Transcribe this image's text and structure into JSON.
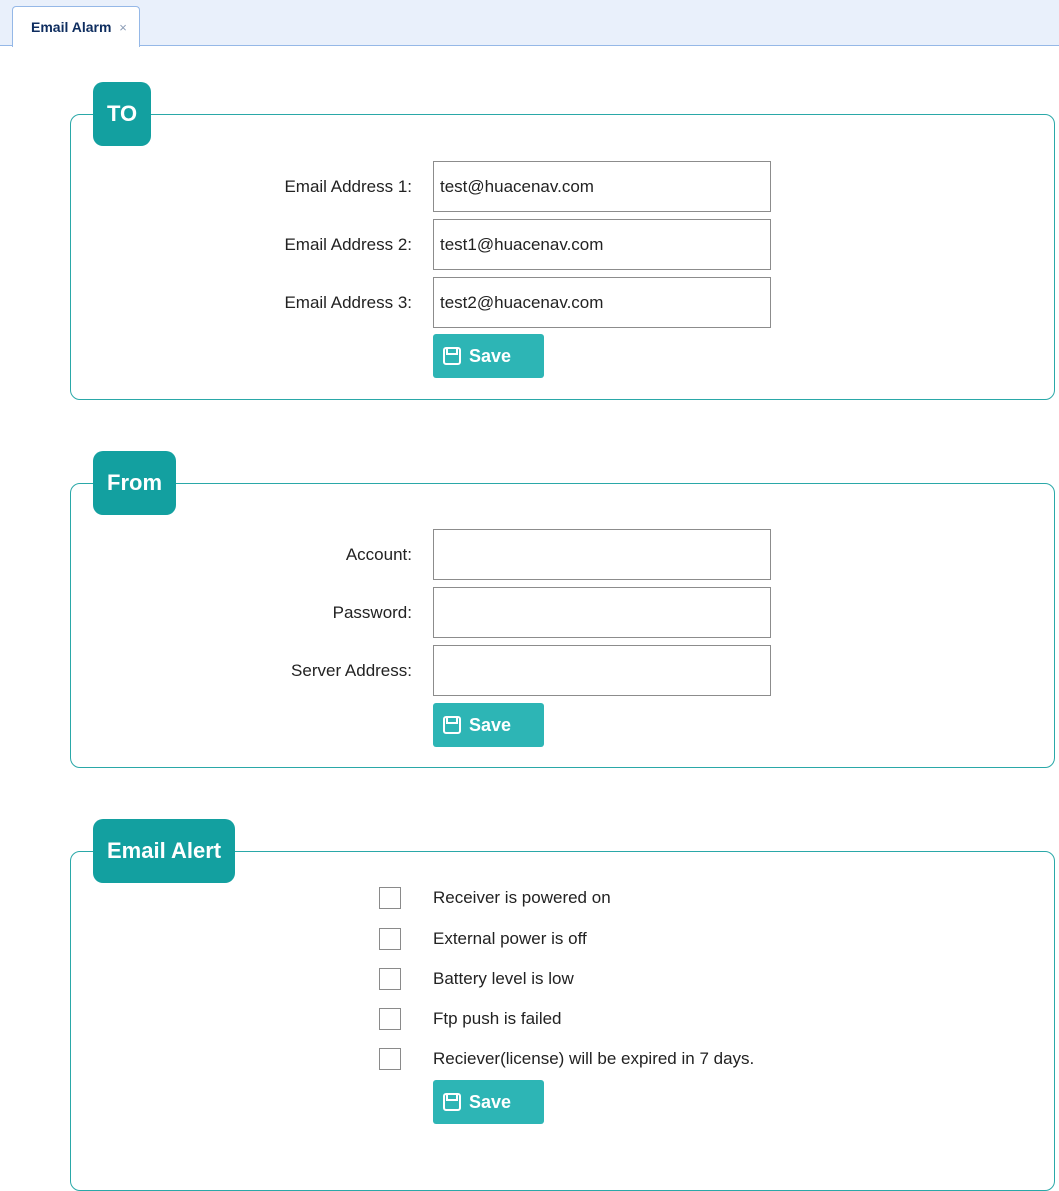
{
  "tab": {
    "label": "Email Alarm",
    "close": "×"
  },
  "to_section": {
    "title": "TO",
    "fields": [
      {
        "label": "Email Address 1:",
        "value": "test@huacenav.com"
      },
      {
        "label": "Email Address 2:",
        "value": "test1@huacenav.com"
      },
      {
        "label": "Email Address 3:",
        "value": "test2@huacenav.com"
      }
    ],
    "save_label": "Save"
  },
  "from_section": {
    "title": "From",
    "fields": [
      {
        "label": "Account:",
        "value": ""
      },
      {
        "label": "Password:",
        "value": ""
      },
      {
        "label": "Server Address:",
        "value": ""
      }
    ],
    "save_label": "Save"
  },
  "alert_section": {
    "title": "Email Alert",
    "options": [
      {
        "label": "Receiver is powered on",
        "checked": false
      },
      {
        "label": "External power is off",
        "checked": false
      },
      {
        "label": "Battery level is low",
        "checked": false
      },
      {
        "label": "Ftp push is failed",
        "checked": false
      },
      {
        "label": "Reciever(license) will be expired in 7 days.",
        "checked": false
      }
    ],
    "save_label": "Save"
  },
  "colors": {
    "accent": "#13a0a0",
    "button": "#2db5b5",
    "tab_bg": "#e9f0fb"
  },
  "icons": {
    "save": "floppy-disk-icon",
    "close": "close-icon"
  }
}
